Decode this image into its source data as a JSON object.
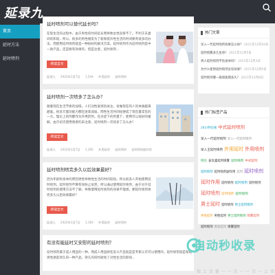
{
  "header": {
    "logo": "延录九"
  },
  "nav": {
    "items": [
      {
        "label": "首页",
        "active": true
      },
      {
        "label": "延时方法",
        "active": false
      },
      {
        "label": "延时喷剂",
        "active": false
      }
    ]
  },
  "posts": [
    {
      "title": "延时喷剂可以替代延长吗？",
      "excerpt": "在现生活的过程中，由于男性的时间延长而导致女性没受不了。不利于夫妻间的和谐，所以，很多的男性朋友为了能够提升性生活的时间要有很多的办法，而使用延时喷剂就是一种很好的解决方案。延时喷剂作为延时喷剂是中一款产品，还是要有效果的，但是注意，延时喷剂...",
      "more": "阅读全文",
      "meta": [
        "延录九",
        "2022年1月7日",
        "1,544",
        "外用延时",
        "延时喷剂"
      ]
    },
    {
      "title": "延时喷剂一次喷多了怎么办？",
      "excerpt": "随着现在生活节奏的加快，人们对性爱感的关注，早做现在的人的体质越来越差，很多方面功能力都在逐渐减弱，而性生活时间短便成了现在最常见的一大。理论上喷剂都作为外用药剂，在对症下的剂量下，使用可以很好的缓解，由于初次使用患者的未注意，延时喷剂一次喷多了怎么办？",
      "more": "阅读全文",
      "meta": [
        "延录九",
        "2022年1月7日",
        "1,392",
        "外用延时",
        "延时喷剂",
        "延时喷剂副作用"
      ]
    },
    {
      "title": "延时喷剂喷完多久以后效果最好？",
      "excerpt": "因为年龄和身体的原因男性导致性生活的时间较短，所以很多人开始使用延时喷剂。延时喷剂不算有效防止早泄，所以通过使用延时喷剂，由于对于延时喷剂的使用方法不了解，导致使用延时喷剂的效果不理想。那延时喷剂喷完多久以后效果最好？",
      "more": "阅读全文",
      "meta": [
        "延录九",
        "2022年1月7日",
        "1,183",
        "外用延时",
        "延时喷剂"
      ]
    },
    {
      "title": "有没有能延时又安慰的延时喷剂？",
      "excerpt": "延时喷剂属于成人用品的一种，而成人用品顾名思义产品就是是专家认可可以使用的，延时喷剂就是帮助男性朋友持久的一种产品，持久的同时避免了对性生活的影响...",
      "more": "阅读全文",
      "meta": [
        "延录九",
        "2022年1月7日"
      ]
    }
  ],
  "sidebar": {
    "hot_title": "热门文章",
    "hot_items": [
      {
        "title": "早入一代延时喷剂效果怎么样？",
        "date": "2021年12月20日"
      },
      {
        "title": "延时喷雾多久生效？",
        "date": "2021年12月5日"
      },
      {
        "title": "男人延时喷剂不伤身体吗？",
        "date": "2021年12月3日"
      },
      {
        "title": "为什么使用延时喷剂没有效果？",
        "date": "2021年12月6日"
      },
      {
        "title": "延时喷剂哪一般保质期多久？",
        "date": "2021年12月8日"
      }
    ],
    "tags_title": "热门标签产品",
    "tags": [
      {
        "label": "24小时在线",
        "color": "#15a0c2",
        "size": 4.4
      },
      {
        "label": "中式延时喷剂",
        "color": "#e8594c",
        "size": 6.5
      },
      {
        "label": "早入一代延时喷剂",
        "color": "#333333",
        "size": 4.6
      },
      {
        "label": "早入一代延时喷剂",
        "color": "#999999",
        "size": 4.4
      },
      {
        "label": "早入王延时喷剂",
        "color": "#333333",
        "size": 4.6
      },
      {
        "label": "外用延时",
        "color": "#f0a028",
        "size": 7
      },
      {
        "label": "外用喷剂",
        "color": "#e8594c",
        "size": 7
      },
      {
        "label": "持久",
        "color": "#2aa44a",
        "size": 4.6
      },
      {
        "label": "安太喜延时喷雾",
        "color": "#333333",
        "size": 4.4
      },
      {
        "label": "延时喷剂",
        "color": "#2aa44a",
        "size": 4.6
      },
      {
        "label": "中式延时",
        "color": "#e8594c",
        "size": 4.6
      },
      {
        "label": "延时喷剂",
        "color": "#15a0c2",
        "size": 4.4
      },
      {
        "label": "延时喷剂副作用",
        "color": "#333333",
        "size": 4.4
      },
      {
        "label": "延时",
        "color": "#999999",
        "size": 4.4
      },
      {
        "label": "延时喷剂",
        "color": "#8d5bc1",
        "size": 7
      },
      {
        "label": "延时作用",
        "color": "#e8594c",
        "size": 7
      },
      {
        "label": "延时喷剂",
        "color": "#333333",
        "size": 4.4
      },
      {
        "label": "延时喷剂",
        "color": "#15a0c2",
        "size": 4.6
      },
      {
        "label": "延时喷剂",
        "color": "#333333",
        "size": 4.4
      },
      {
        "label": "延时喷剂",
        "color": "#e8594c",
        "size": 7
      },
      {
        "label": "延时喷剂",
        "color": "#f0a028",
        "size": 4.6
      },
      {
        "label": "延时喷剂",
        "color": "#2aa44a",
        "size": 4.6
      },
      {
        "label": "男士延时",
        "color": "#e8594c",
        "size": 7
      },
      {
        "label": "延时喷剂",
        "color": "#333333",
        "size": 4.4
      },
      {
        "label": "男士延时喷剂",
        "color": "#15a0c2",
        "size": 4.4
      },
      {
        "label": "男性延时",
        "color": "#f0a028",
        "size": 4.4
      },
      {
        "label": "男性延时",
        "color": "#333333",
        "size": 4.4
      },
      {
        "label": "男士延时喷剂",
        "color": "#2aa44a",
        "size": 4.4
      },
      {
        "label": "喷雾延时",
        "color": "#e8594c",
        "size": 4.4
      },
      {
        "label": "延时喷剂",
        "color": "#333333",
        "size": 4.4
      },
      {
        "label": "香氛延时",
        "color": "#999999",
        "size": 4.4
      },
      {
        "label": "喷雾延时",
        "color": "#333333",
        "size": 4.4
      }
    ]
  },
  "watermark": {
    "title": "自动秒收录",
    "subtitle": "做 上 流 量 一 一 次 一 一 次 一 上 流"
  }
}
